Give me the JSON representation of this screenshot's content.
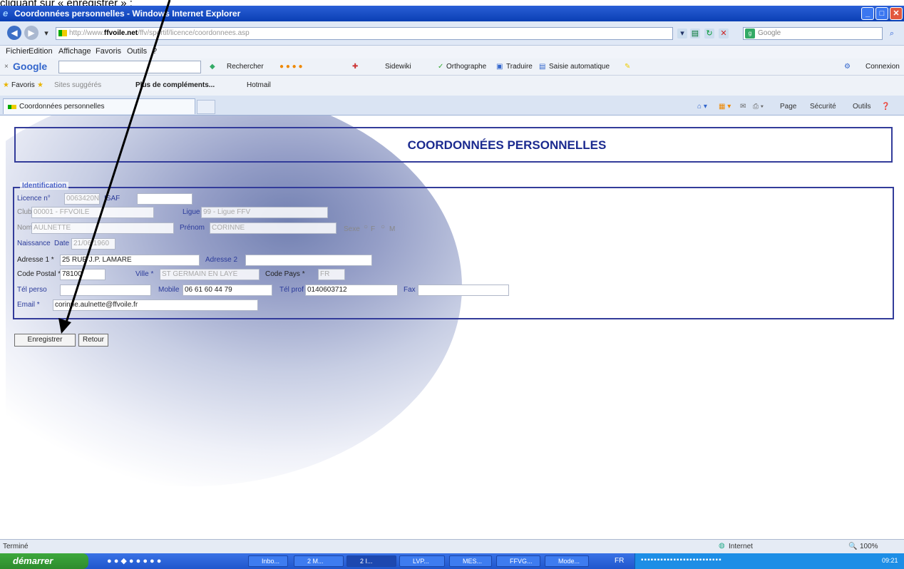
{
  "caption": "cliquant sur « enregistrer » :",
  "window": {
    "title": "Coordonnées personnelles - Windows Internet Explorer"
  },
  "address": {
    "url_prefix": "http://www.",
    "domain": "ffvoile.net",
    "url_rest": "/ffv/sportif/licence/coordonnees.asp",
    "search_placeholder": "Google"
  },
  "menu": {
    "items": [
      "Fichier",
      "Edition",
      "Affichage",
      "Favoris",
      "Outils",
      "?"
    ]
  },
  "googlebar": {
    "brand": "Google",
    "items": [
      "Rechercher",
      "Sidewiki",
      "Orthographe",
      "Traduire",
      "Saisie automatique"
    ],
    "signin": "Connexion"
  },
  "favorites": {
    "label": "Favoris",
    "suggested": "Sites suggérés",
    "more": "Plus de compléments...",
    "hotmail": "Hotmail"
  },
  "tab": {
    "label": "Coordonnées personnelles"
  },
  "commandbar": {
    "items": [
      "Page",
      "Sécurité",
      "Outils"
    ]
  },
  "page": {
    "title": "COORDONNÉES PERSONNELLES",
    "legend": "Identification",
    "fields": {
      "licence_label": "Licence n°",
      "licence_value": "0063420N",
      "isaf_label": "ISAF",
      "isaf_value": "",
      "club_label": "Club",
      "club_value": "00001 - FFVOILE",
      "ligue_label": "Ligue",
      "ligue_value": "99 - Ligue FFV",
      "nom_label": "Nom",
      "nom_value": "AULNETTE",
      "prenom_label": "Prénom",
      "prenom_value": "CORINNE",
      "sexe_label": "Sexe",
      "sexe_f": "F",
      "sexe_m": "M",
      "naissance_label": "Naissance",
      "date_label": "Date",
      "date_value": "21/06/1960",
      "adresse1_label": "Adresse 1 *",
      "adresse1_value": "25 RUE J.P. LAMARE",
      "adresse2_label": "Adresse 2",
      "adresse2_value": "",
      "cp_label": "Code Postal *",
      "cp_value": "78100",
      "ville_label": "Ville *",
      "ville_value": "ST GERMAIN EN LAYE",
      "codepays_label": "Code Pays *",
      "codepays_value": "FR",
      "telperso_label": "Tél perso",
      "telperso_value": "",
      "mobile_label": "Mobile",
      "mobile_value": "06 61 60 44 79",
      "telprof_label": "Tél prof",
      "telprof_value": "0140603712",
      "fax_label": "Fax",
      "fax_value": "",
      "email_label": "Email *",
      "email_value": "corinne.aulnette@ffvoile.fr"
    },
    "buttons": {
      "save": "Enregistrer",
      "back": "Retour"
    }
  },
  "status": {
    "left": "Terminé",
    "zone": "Internet",
    "zoom": "100%"
  },
  "taskbar": {
    "start": "démarrer",
    "clock": "09:21",
    "lang": "FR",
    "tasks": [
      "Inbo...",
      "2 M...",
      "2 I...",
      "LVP...",
      "MES...",
      "FFVG...",
      "Mode..."
    ]
  }
}
